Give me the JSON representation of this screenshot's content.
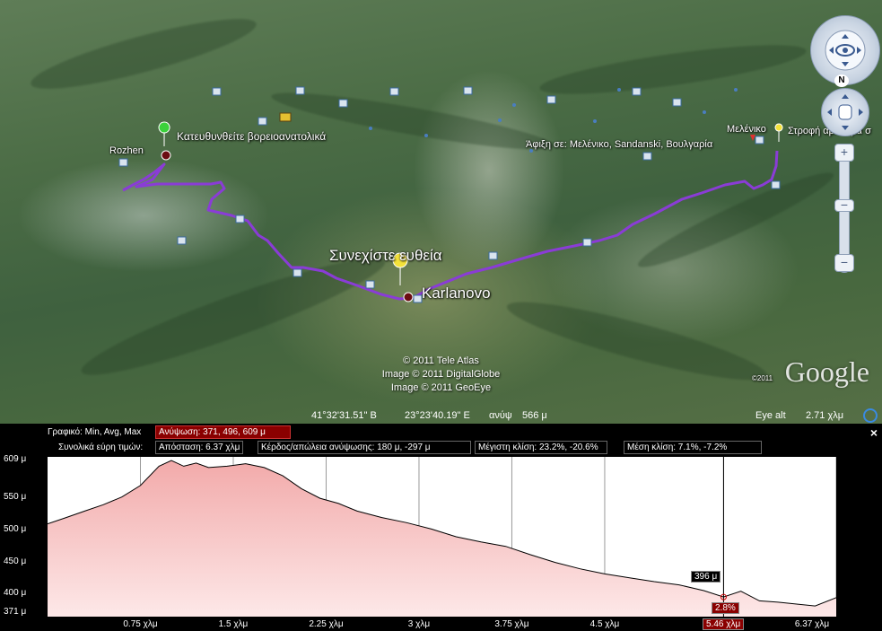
{
  "map": {
    "start_label": "Rozhen",
    "start_instruction": "Κατευθυνθείτε βορειοανατολικά",
    "continue_instruction": "Συνεχίστε ευθεία",
    "waypoint_label": "Karlanovo",
    "arrival_text": "Άφιξη σε: Μελένικο, Sandanski, Βουλγαρία",
    "end_label": "Μελένικο",
    "turn_instruction": "Στροφή αριστερά σ",
    "credits": [
      "© 2011 Tele Atlas",
      "Image © 2011 DigitalGlobe",
      "Image © 2011 GeoEye"
    ],
    "google_logo": "Google",
    "google_year": "©2011",
    "route_color": "#8a3cd6",
    "nav_north": "N"
  },
  "statusbar": {
    "lat": "41°32'31.51\" B",
    "lon": "23°23'40.19\" E",
    "elev_label": "ανύψ",
    "elev_value": "566 μ",
    "eye_alt_label": "Eye alt",
    "eye_alt_value": "2.71 χλμ"
  },
  "profile": {
    "close": "×",
    "graph_label": "Γραφικό: Min, Avg, Max",
    "elevation_stat": "Ανύψωση: 371, 496, 609 μ",
    "range_label": "Συνολικά εύρη τιμών:",
    "distance_stat": "Απόσταση: 6.37 χλμ",
    "gain_stat": "Κέρδος/απώλεια ανύψωσης: 180 μ, -297 μ",
    "max_slope_stat": "Μέγιστη κλίση: 23.2%, -20.6%",
    "avg_slope_stat": "Μέση κλίση: 7.1%, -7.2%",
    "cursor_elev": "396 μ",
    "cursor_slope": "2.8%",
    "cursor_dist": "5.46 χλμ",
    "fill_color": "#f7c9c9",
    "line_color": "#000000"
  },
  "chart_data": {
    "type": "area",
    "x_unit": "χλμ",
    "y_unit": "μ",
    "ylim": [
      371,
      609
    ],
    "xlim": [
      0,
      6.37
    ],
    "y_ticks": [
      "609 μ",
      "550 μ",
      "500 μ",
      "450 μ",
      "400 μ",
      "371 μ"
    ],
    "y_tick_values": [
      609,
      550,
      500,
      450,
      400,
      371
    ],
    "x_ticks": [
      "0.75 χλμ",
      "1.5 χλμ",
      "2.25 χλμ",
      "3 χλμ",
      "3.75 χλμ",
      "4.5 χλμ",
      "5.46 χλμ",
      "6.37 χλμ"
    ],
    "x_tick_values": [
      0.75,
      1.5,
      2.25,
      3.0,
      3.75,
      4.5,
      5.46,
      6.37
    ],
    "x": [
      0,
      0.15,
      0.3,
      0.45,
      0.6,
      0.75,
      0.9,
      1.0,
      1.1,
      1.2,
      1.3,
      1.45,
      1.6,
      1.75,
      1.9,
      2.05,
      2.2,
      2.35,
      2.5,
      2.7,
      2.9,
      3.1,
      3.3,
      3.5,
      3.7,
      3.9,
      4.1,
      4.3,
      4.5,
      4.7,
      4.9,
      5.1,
      5.3,
      5.46,
      5.6,
      5.75,
      5.9,
      6.05,
      6.2,
      6.37
    ],
    "y": [
      510,
      520,
      530,
      540,
      552,
      570,
      600,
      609,
      600,
      605,
      598,
      600,
      604,
      598,
      585,
      565,
      550,
      542,
      530,
      520,
      512,
      502,
      490,
      482,
      475,
      462,
      450,
      440,
      432,
      426,
      420,
      415,
      406,
      396,
      405,
      390,
      388,
      385,
      382,
      395
    ]
  }
}
